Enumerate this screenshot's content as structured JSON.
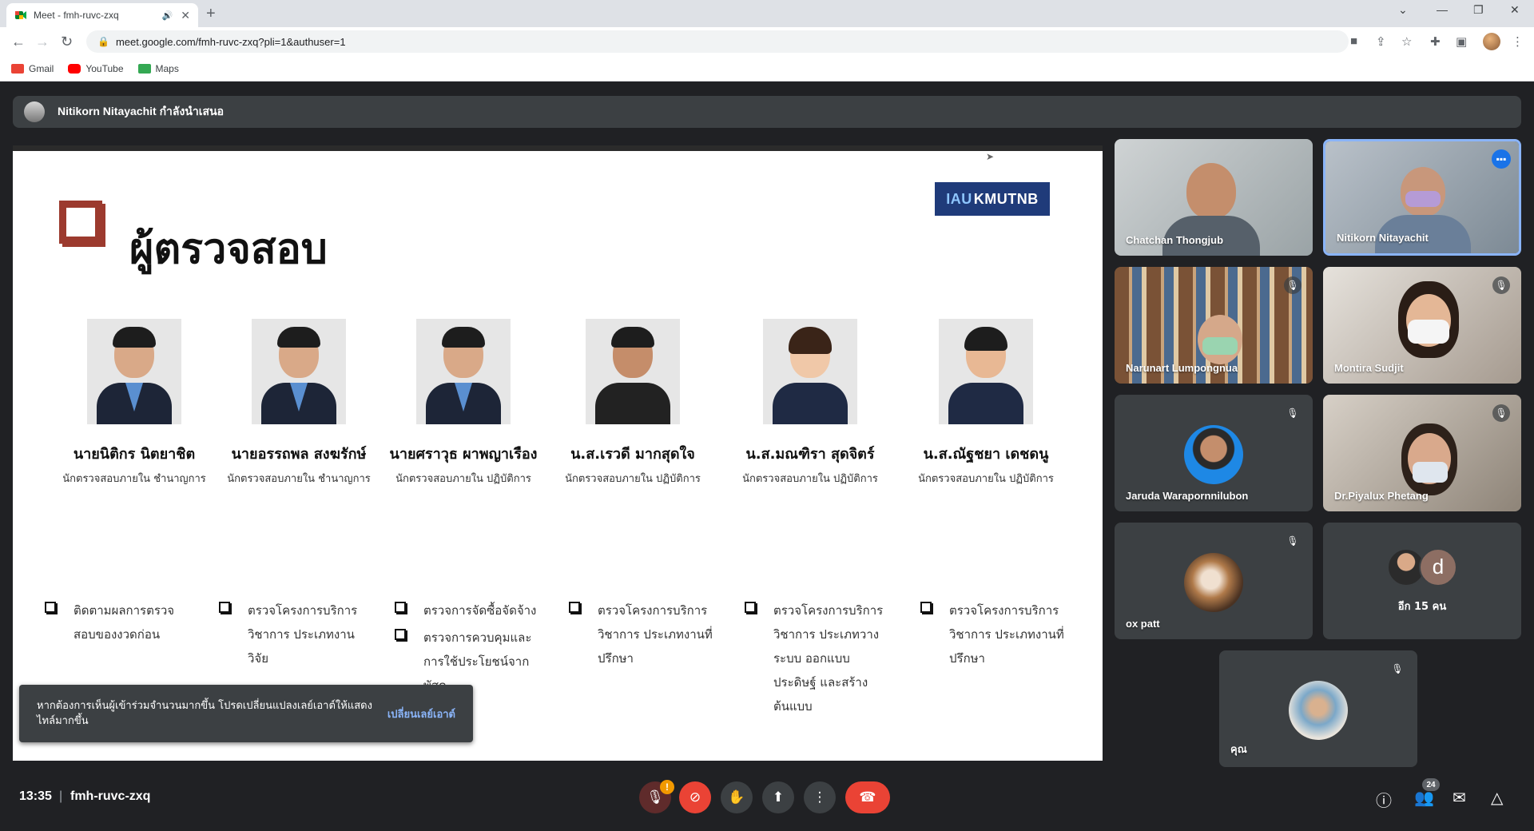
{
  "browser": {
    "tab_title": "Meet - fmh-ruvc-zxq",
    "url": "meet.google.com/fmh-ruvc-zxq?pli=1&authuser=1",
    "bookmarks": [
      {
        "label": "Gmail",
        "icon": "gmail-icon",
        "color": "#ea4335"
      },
      {
        "label": "YouTube",
        "icon": "youtube-icon",
        "color": "#ff0000"
      },
      {
        "label": "Maps",
        "icon": "maps-icon",
        "color": "#34a853"
      }
    ]
  },
  "presenting": {
    "text": "Nitikorn Nitayachit กำลังนำเสนอ"
  },
  "slide": {
    "title": "ผู้ตรวจสอบ",
    "logo": {
      "part1": "IAU",
      "part2": "KMUTNB"
    },
    "members": [
      {
        "name": "นายนิติกร  นิตยาชิต",
        "role": "นักตรวจสอบภายใน ชำนาญการ",
        "duties": [
          "ติดตามผลการตรวจสอบของงวดก่อน"
        ]
      },
      {
        "name": "นายอรรถพล สงฆรักษ์",
        "role": "นักตรวจสอบภายใน ชำนาญการ",
        "duties": [
          "ตรวจโครงการบริการวิชาการ ประเภทงานวิจัย"
        ]
      },
      {
        "name": "นายศราวุธ  ผาพญาเรือง",
        "role": "นักตรวจสอบภายใน ปฏิบัติการ",
        "duties": [
          "ตรวจการจัดซื้อจัดจ้าง",
          "ตรวจการควบคุมและการใช้ประโยชน์จากพัสดุ"
        ]
      },
      {
        "name": "น.ส.เรวดี  มากสุดใจ",
        "role": "นักตรวจสอบภายใน ปฏิบัติการ",
        "duties": [
          "ตรวจโครงการบริการวิชาการ ประเภทงานที่ปรึกษา"
        ]
      },
      {
        "name": "น.ส.มณฑิรา  สุดจิตร์",
        "role": "นักตรวจสอบภายใน ปฏิบัติการ",
        "duties": [
          "ตรวจโครงการบริการวิชาการ ประเภทวางระบบ ออกแบบประดิษฐ์ และสร้างต้นแบบ"
        ]
      },
      {
        "name": "น.ส.ณัฐชยา  เดชดนู",
        "role": "นักตรวจสอบภายใน ปฏิบัติการ",
        "duties": [
          "ตรวจโครงการบริการวิชาการ ประเภทงานที่ปรึกษา"
        ]
      }
    ]
  },
  "toast": {
    "message": "หากต้องการเห็นผู้เข้าร่วมจำนวนมากขึ้น โปรดเปลี่ยนแปลงเลย์เอาต์ให้แสดงไทล์มากขึ้น",
    "action": "เปลี่ยนเลย์เอาต์"
  },
  "participants": [
    {
      "name": "Chatchan Thongjub",
      "type": "video"
    },
    {
      "name": "Nitikorn Nitayachit",
      "type": "video",
      "speaking": true
    },
    {
      "name": "Narunart Lumpongnua",
      "type": "video",
      "muted": true
    },
    {
      "name": "Montira Sudjit",
      "type": "video",
      "muted": true
    },
    {
      "name": "Jaruda Warapornnilubon",
      "type": "avatar",
      "muted": true
    },
    {
      "name": "Dr.Piyalux Phetang",
      "type": "video",
      "muted": true
    },
    {
      "name": "ox patt",
      "type": "avatar",
      "muted": true
    },
    {
      "name": "คุณ",
      "type": "avatar",
      "muted": true
    }
  ],
  "others": {
    "initial": "d",
    "label": "อีก 15 คน"
  },
  "bottom": {
    "time": "13:35",
    "meeting_code": "fmh-ruvc-zxq",
    "participant_count": "24",
    "warn_badge": "!"
  },
  "colors": {
    "accent": "#1a73e8",
    "end_call": "#ea4335",
    "slide_square": "#9c3a2e"
  }
}
